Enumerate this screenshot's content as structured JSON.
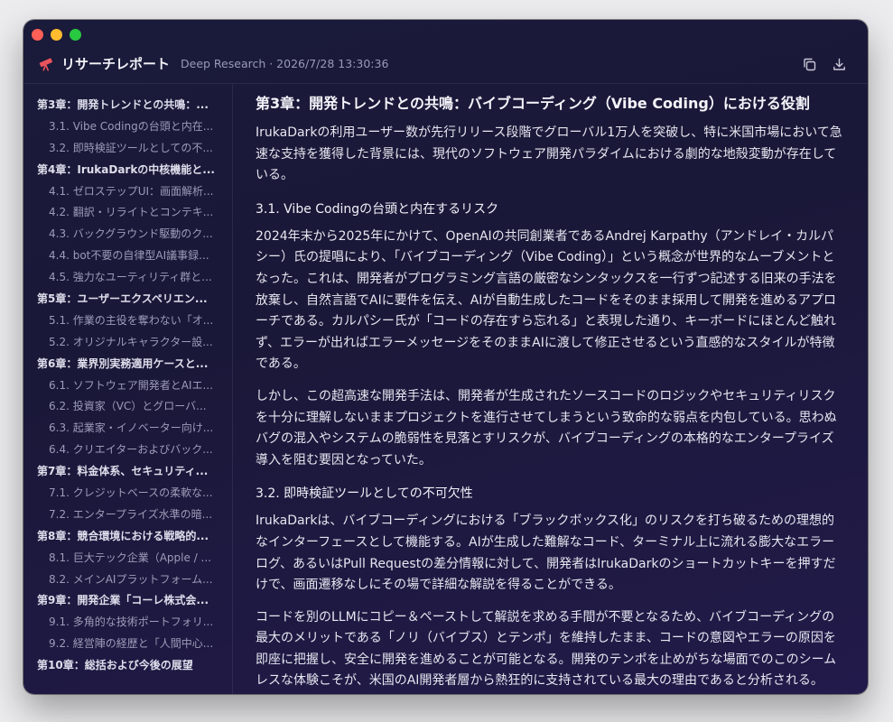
{
  "window": {
    "title": "リサーチレポート",
    "subtitle": "Deep Research · 2026/7/28 13:30:36"
  },
  "toolbar": {
    "copy_icon": "copy-icon",
    "download_icon": "download-icon"
  },
  "toc": [
    {
      "kind": "chapter",
      "label": "第3章：開発トレンドとの共鳴：..."
    },
    {
      "kind": "section",
      "label": "3.1. Vibe Codingの台頭と内在..."
    },
    {
      "kind": "section",
      "label": "3.2. 即時検証ツールとしての不..."
    },
    {
      "kind": "chapter",
      "label": "第4章：IrukaDarkの中核機能と..."
    },
    {
      "kind": "section",
      "label": "4.1. ゼロステップUI：画面解析..."
    },
    {
      "kind": "section",
      "label": "4.2. 翻訳・リライトとコンテキ..."
    },
    {
      "kind": "section",
      "label": "4.3. バックグラウンド駆動のク..."
    },
    {
      "kind": "section",
      "label": "4.4. bot不要の自律型AI議事録..."
    },
    {
      "kind": "section",
      "label": "4.5. 強力なユーティリティ群と..."
    },
    {
      "kind": "chapter",
      "label": "第5章：ユーザーエクスペリエン..."
    },
    {
      "kind": "section",
      "label": "5.1. 作業の主役を奪わない「オ..."
    },
    {
      "kind": "section",
      "label": "5.2. オリジナルキャラクター設..."
    },
    {
      "kind": "chapter",
      "label": "第6章：業界別実務適用ケースと..."
    },
    {
      "kind": "section",
      "label": "6.1. ソフトウェア開発者とAIエ..."
    },
    {
      "kind": "section",
      "label": "6.2. 投資家（VC）とグローバ..."
    },
    {
      "kind": "section",
      "label": "6.3. 起業家・イノベーター向け..."
    },
    {
      "kind": "section",
      "label": "6.4. クリエイターおよびバック..."
    },
    {
      "kind": "chapter",
      "label": "第7章：料金体系、セキュリティ..."
    },
    {
      "kind": "section",
      "label": "7.1. クレジットベースの柔軟な..."
    },
    {
      "kind": "section",
      "label": "7.2. エンタープライズ水準の暗..."
    },
    {
      "kind": "chapter",
      "label": "第8章：競合環境における戦略的..."
    },
    {
      "kind": "section",
      "label": "8.1. 巨大テック企業（Apple / ..."
    },
    {
      "kind": "section",
      "label": "8.2. メインAIプラットフォーム..."
    },
    {
      "kind": "chapter",
      "label": "第9章：開発企業「コーレ株式会..."
    },
    {
      "kind": "section",
      "label": "9.1. 多角的な技術ポートフォリ..."
    },
    {
      "kind": "section",
      "label": "9.2. 経営陣の経歴と「人間中心..."
    },
    {
      "kind": "chapter",
      "label": "第10章：総括および今後の展望"
    }
  ],
  "content": {
    "heading": "第3章：開発トレンドとの共鳴：バイブコーディング（Vibe Coding）における役割",
    "intro": "IrukaDarkの利用ユーザー数が先行リリース段階でグローバル1万人を突破し、特に米国市場において急速な支持を獲得した背景には、現代のソフトウェア開発パラダイムにおける劇的な地殻変動が存在している。",
    "section1_title": "3.1. Vibe Codingの台頭と内在するリスク",
    "section1_p1": "2024年末から2025年にかけて、OpenAIの共同創業者であるAndrej Karpathy（アンドレイ・カルパシー）氏の提唱により、「バイブコーディング（Vibe Coding）」という概念が世界的なムーブメントとなった。これは、開発者がプログラミング言語の厳密なシンタックスを一行ずつ記述する旧来の手法を放棄し、自然言語でAIに要件を伝え、AIが自動生成したコードをそのまま採用して開発を進めるアプローチである。カルパシー氏が「コードの存在すら忘れる」と表現した通り、キーボードにほとんど触れず、エラーが出ればエラーメッセージをそのままAIに渡して修正させるという直感的なスタイルが特徴である。",
    "section1_p2": "しかし、この超高速な開発手法は、開発者が生成されたソースコードのロジックやセキュリティリスクを十分に理解しないままプロジェクトを進行させてしまうという致命的な弱点を内包している。思わぬバグの混入やシステムの脆弱性を見落とすリスクが、バイブコーディングの本格的なエンタープライズ導入を阻む要因となっていた。",
    "section2_title": "3.2. 即時検証ツールとしての不可欠性",
    "section2_p1": "IrukaDarkは、バイブコーディングにおける「ブラックボックス化」のリスクを打ち破るための理想的なインターフェースとして機能する。AIが生成した難解なコード、ターミナル上に流れる膨大なエラーログ、あるいはPull Requestの差分情報に対して、開発者はIrukaDarkのショートカットキーを押すだけで、画面遷移なしにその場で詳細な解説を得ることができる。",
    "section2_p2": "コードを別のLLMにコピー＆ペーストして解説を求める手間が不要となるため、バイブコーディングの最大のメリットである「ノリ（バイブス）とテンポ」を維持したまま、コードの意図やエラーの原因を即座に把握し、安全に開発を進めることが可能となる。開発のテンポを止めがちな場面でのこのシームレスな体験こそが、米国のAI開発者層から熱狂的に支持されている最大の理由であると分析される。"
  },
  "colors": {
    "window_bg": "#1a1a3a",
    "accent_red": "#fe5f57",
    "accent_yellow": "#febc2e",
    "accent_green": "#28c840"
  }
}
